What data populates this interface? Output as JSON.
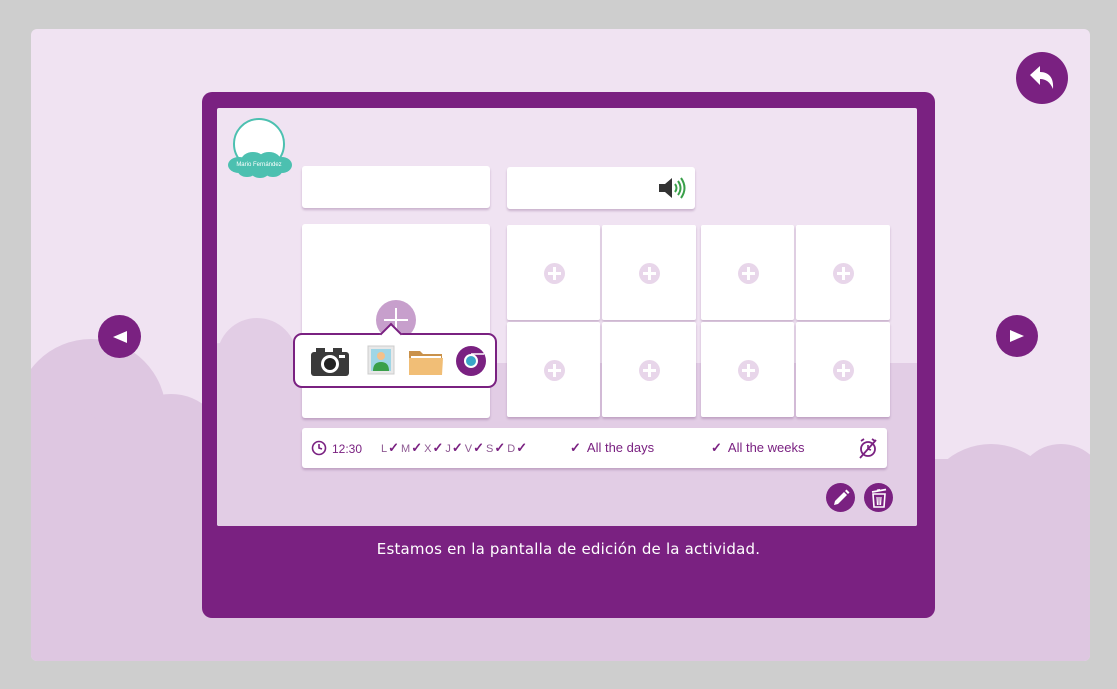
{
  "caption": "Estamos en la pantalla de edición de la actividad.",
  "user": {
    "name": "Mario Fernández"
  },
  "fields": {
    "title_value": "",
    "audio_value": ""
  },
  "nav": {
    "back_icon": "undo-arrow-icon",
    "prev_icon": "left-triangle-icon",
    "next_icon": "right-triangle-icon"
  },
  "media_picker": {
    "icons": [
      "camera-icon",
      "gallery-icon",
      "folder-icon",
      "browser-icon"
    ]
  },
  "grid": {
    "rows": 2,
    "columns": 4
  },
  "schedule": {
    "time": "12:30",
    "days": [
      {
        "label": "L",
        "checked": true
      },
      {
        "label": "M",
        "checked": true
      },
      {
        "label": "X",
        "checked": true
      },
      {
        "label": "J",
        "checked": true
      },
      {
        "label": "V",
        "checked": true
      },
      {
        "label": "S",
        "checked": true
      },
      {
        "label": "D",
        "checked": true
      }
    ],
    "all_days": "All the days",
    "all_weeks": "All the weeks",
    "check_glyph": "✓"
  },
  "actions": {
    "edit_icon": "pencil-icon",
    "delete_icon": "trash-icon"
  },
  "colors": {
    "primary": "#7a2181",
    "background": "#f0e3f2",
    "hills": "#dec7e1",
    "accent_teal": "#4cc0b0",
    "speaker_green": "#3aa04a"
  }
}
